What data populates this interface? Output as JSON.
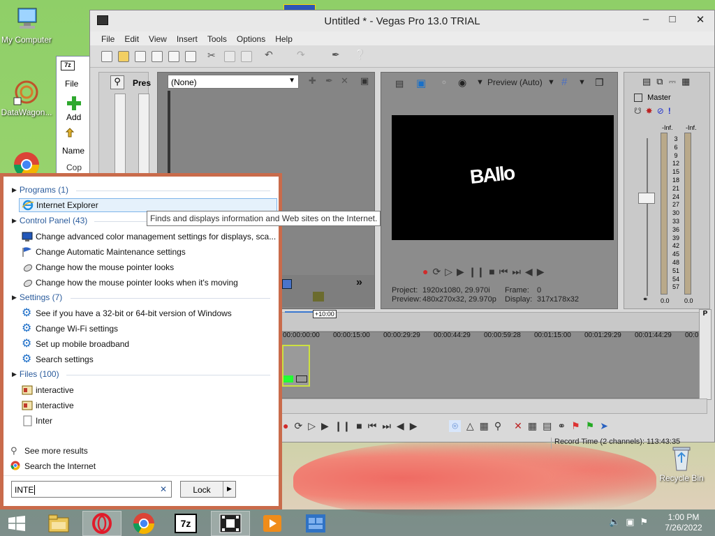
{
  "desktop": {
    "icons": [
      {
        "label": "My Computer",
        "icon": "computer-icon"
      },
      {
        "label": "DataWagon...",
        "icon": "datawagon-icon"
      },
      {
        "label": "Recycle Bin",
        "icon": "recycle-bin-icon"
      }
    ]
  },
  "vegas": {
    "title": "Untitled * - Vegas Pro 13.0 TRIAL",
    "menu": [
      "File",
      "Edit",
      "View",
      "Insert",
      "Tools",
      "Options",
      "Help"
    ],
    "explorer_dropdown": "(None)",
    "explorer_label": "Pres",
    "preview_mode": "Preview (Auto)",
    "preview_text": "BAllo",
    "master_label": "Master",
    "meter_left": "-Inf.",
    "meter_right": "-Inf.",
    "meter_scale": [
      "3",
      "6",
      "9",
      "12",
      "15",
      "18",
      "21",
      "24",
      "27",
      "30",
      "33",
      "36",
      "39",
      "42",
      "45",
      "48",
      "51",
      "54",
      "57"
    ],
    "fader_left": "0.0",
    "fader_right": "0.0",
    "project_label": "Project:",
    "project_value": "1920x1080, 29.970i",
    "preview_label": "Preview:",
    "preview_value": "480x270x32, 29.970p",
    "frame_label": "Frame:",
    "frame_value": "0",
    "display_label": "Display:",
    "display_value": "317x178x32",
    "time_marker": "+10:00",
    "ruler": [
      "00:00:00:00",
      "00:00:15:00",
      "00:00:29:29",
      "00:00:44:29",
      "00:00:59:28",
      "00:01:15:00",
      "00:01:29:29",
      "00:01:44:29",
      "00:0"
    ],
    "record_time": "Record Time (2 channels): 113:43:35"
  },
  "sevenz": {
    "title_icon": "7z",
    "file_menu": "File",
    "add_label": "Add",
    "name_col": "Name",
    "row": "Cop"
  },
  "search": {
    "groups": {
      "programs": "Programs (1)",
      "control_panel": "Control Panel (43)",
      "settings": "Settings (7)",
      "files": "Files (100)"
    },
    "programs": [
      "Internet Explorer"
    ],
    "control_panel": [
      "Change advanced color management settings for displays, sca...",
      "Change Automatic Maintenance settings",
      "Change how the mouse pointer looks",
      "Change how the mouse pointer looks when it's moving"
    ],
    "settings": [
      "See if you have a 32-bit or 64-bit version of Windows",
      "Change Wi-Fi settings",
      "Set up mobile broadband",
      "Search settings"
    ],
    "files": [
      "interactive",
      "interactive",
      "Inter"
    ],
    "see_more": "See more results",
    "search_internet": "Search the Internet",
    "query": "INTE",
    "lock_label": "Lock",
    "tooltip": "Finds and displays information and Web sites on the Internet."
  },
  "taskbar": {
    "clock_time": "1:00 PM",
    "clock_date": "7/26/2022",
    "apps": [
      "windows-start-icon",
      "file-explorer-icon",
      "opera-icon",
      "chrome-icon",
      "7zip-icon",
      "vegas-icon",
      "media-player-icon",
      "app-tile-icon"
    ]
  }
}
